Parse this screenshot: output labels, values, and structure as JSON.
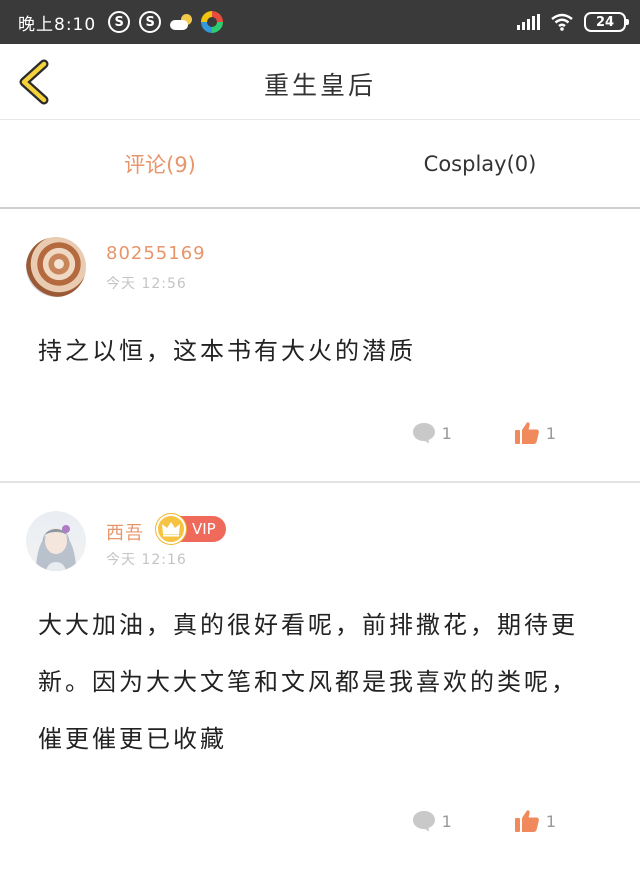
{
  "status_bar": {
    "time": "晚上8:10",
    "sg_icon_1": "S",
    "sg_icon_2": "S",
    "battery": "24",
    "icons": [
      "sogou-icon",
      "sogou-icon",
      "weather-icon",
      "app-icon",
      "signal-icon",
      "wifi-icon",
      "battery-icon"
    ]
  },
  "header": {
    "title": "重生皇后",
    "back_icon": "chevron-left-icon"
  },
  "tabs": [
    {
      "label": "评论(9)",
      "active": true
    },
    {
      "label": "Cosplay(0)",
      "active": false
    }
  ],
  "comments": [
    {
      "username": "80255169",
      "time": "今天 12:56",
      "vip": false,
      "text": "持之以恒，这本书有大火的潜质",
      "reply_count": "1",
      "like_count": "1"
    },
    {
      "username": "西吾",
      "time": "今天 12:16",
      "vip": true,
      "vip_label": "VIP",
      "text": "大大加油，真的很好看呢，前排撒花，期待更新。因为大大文笔和文风都是我喜欢的类呢，催更催更已收藏",
      "reply_count": "1",
      "like_count": "1"
    }
  ],
  "colors": {
    "accent": "#e8956a",
    "status_bar": "#3a3a3a",
    "vip": "#f06a5c",
    "like": "#f08a5d"
  }
}
